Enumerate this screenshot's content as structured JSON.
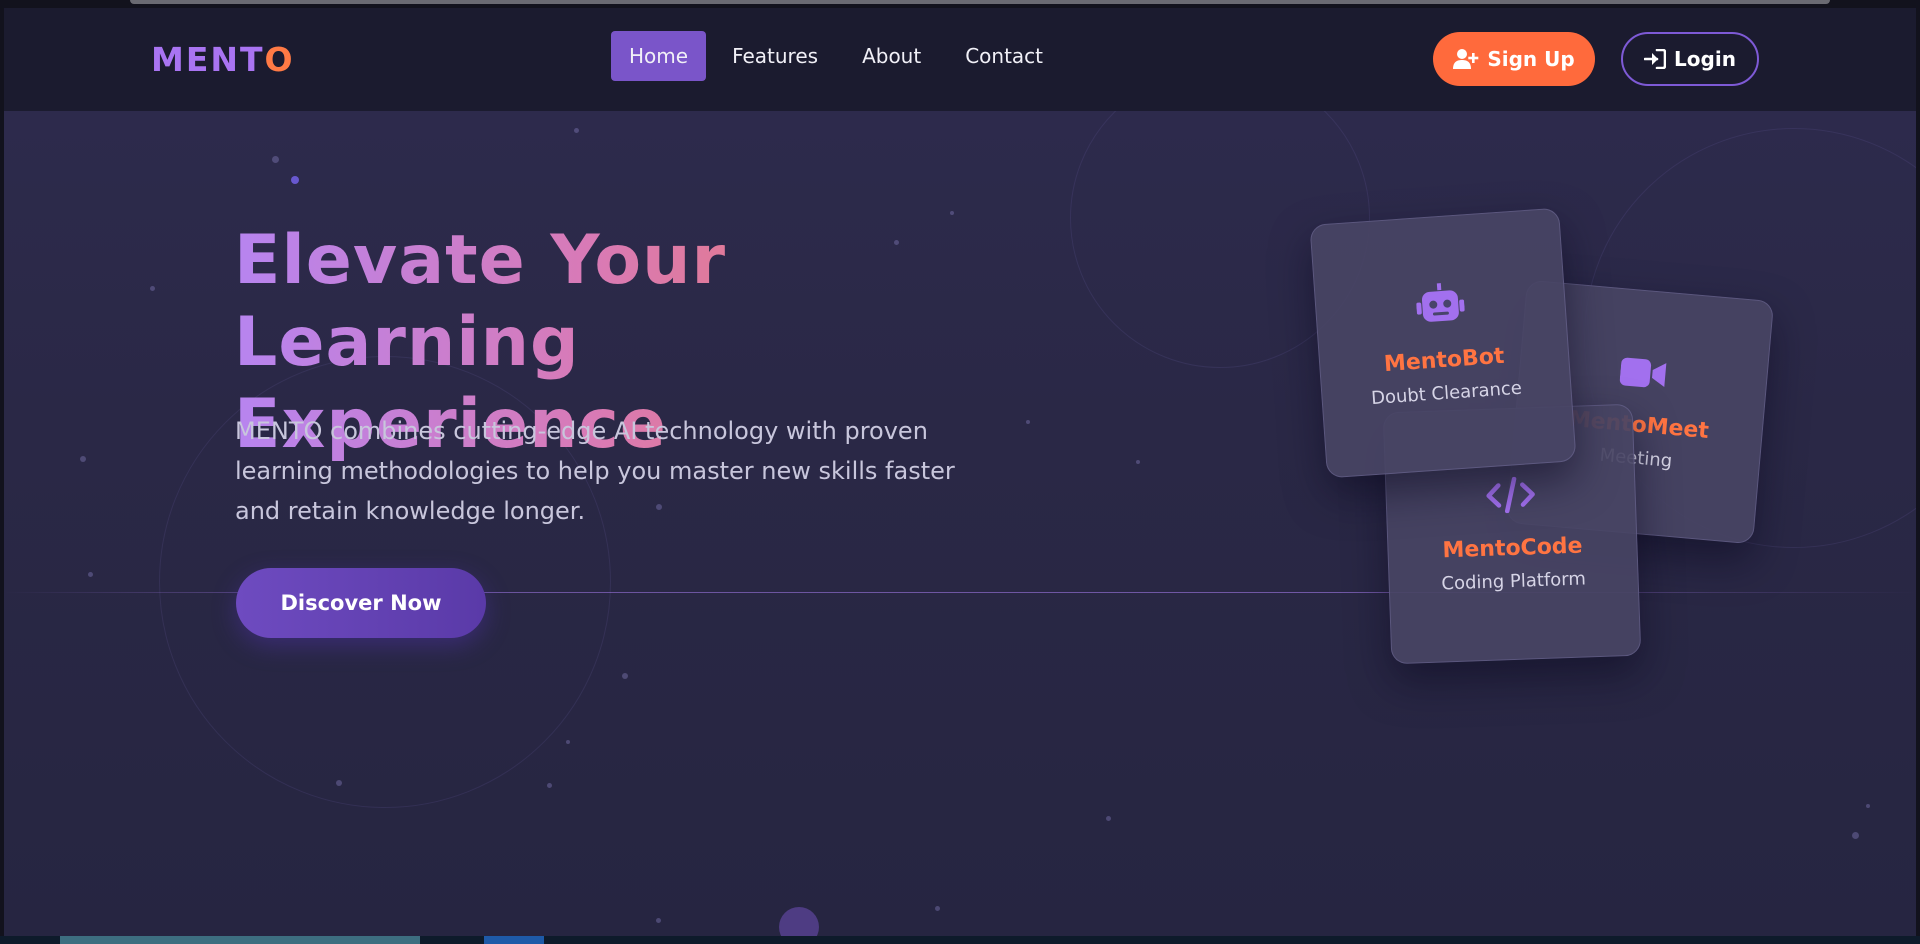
{
  "nav": {
    "logo_main": "MENT",
    "logo_accent": "O",
    "links": [
      {
        "label": "Home",
        "active": true
      },
      {
        "label": "Features",
        "active": false
      },
      {
        "label": "About",
        "active": false
      },
      {
        "label": "Contact",
        "active": false
      }
    ],
    "signup_label": "Sign Up",
    "login_label": "Login"
  },
  "hero": {
    "title_line1": "Elevate Your",
    "title_line2": "Learning Experience",
    "description": "MENTO combines cutting-edge AI technology with proven learning methodologies to help you master new skills faster and retain knowledge longer.",
    "cta_label": "Discover Now"
  },
  "cards": [
    {
      "title": "MentoBot",
      "subtitle": "Doubt Clearance",
      "icon": "robot-icon"
    },
    {
      "title": "MentoMeet",
      "subtitle": "Meeting",
      "icon": "video-camera-icon"
    },
    {
      "title": "MentoCode",
      "subtitle": "Coding Platform",
      "icon": "code-icon"
    }
  ],
  "colors": {
    "brand_purple": "#a974f2",
    "brand_orange": "#ff7a45",
    "signup_bg": "#ff6a3c",
    "active_nav_bg": "#7a55c9",
    "page_bg": "#2a2846"
  }
}
